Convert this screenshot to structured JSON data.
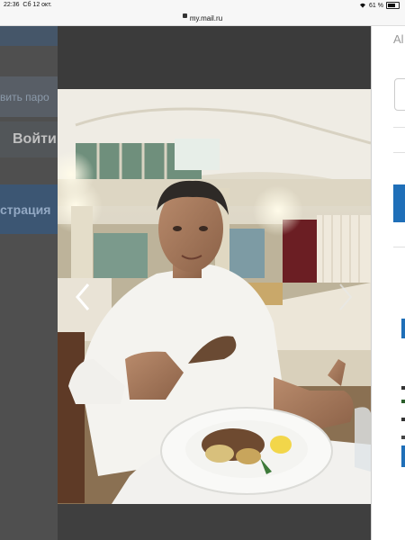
{
  "statusbar": {
    "time": "22:36",
    "date": "Сб 12 окт.",
    "battery": "61 %",
    "battery_level": 0.61
  },
  "urlbar": {
    "url": "my.mail.ru"
  },
  "left_panel": {
    "password_button": "вить паро",
    "login_button": "Войти",
    "register_button": "страция"
  },
  "right_panel": {
    "label": "Al"
  },
  "photo": {
    "prev_icon": "chevron-left-icon",
    "next_icon": "chevron-right-icon"
  },
  "colors": {
    "accent_blue": "#1f6fb8",
    "overlay": "#3b3b3b"
  }
}
